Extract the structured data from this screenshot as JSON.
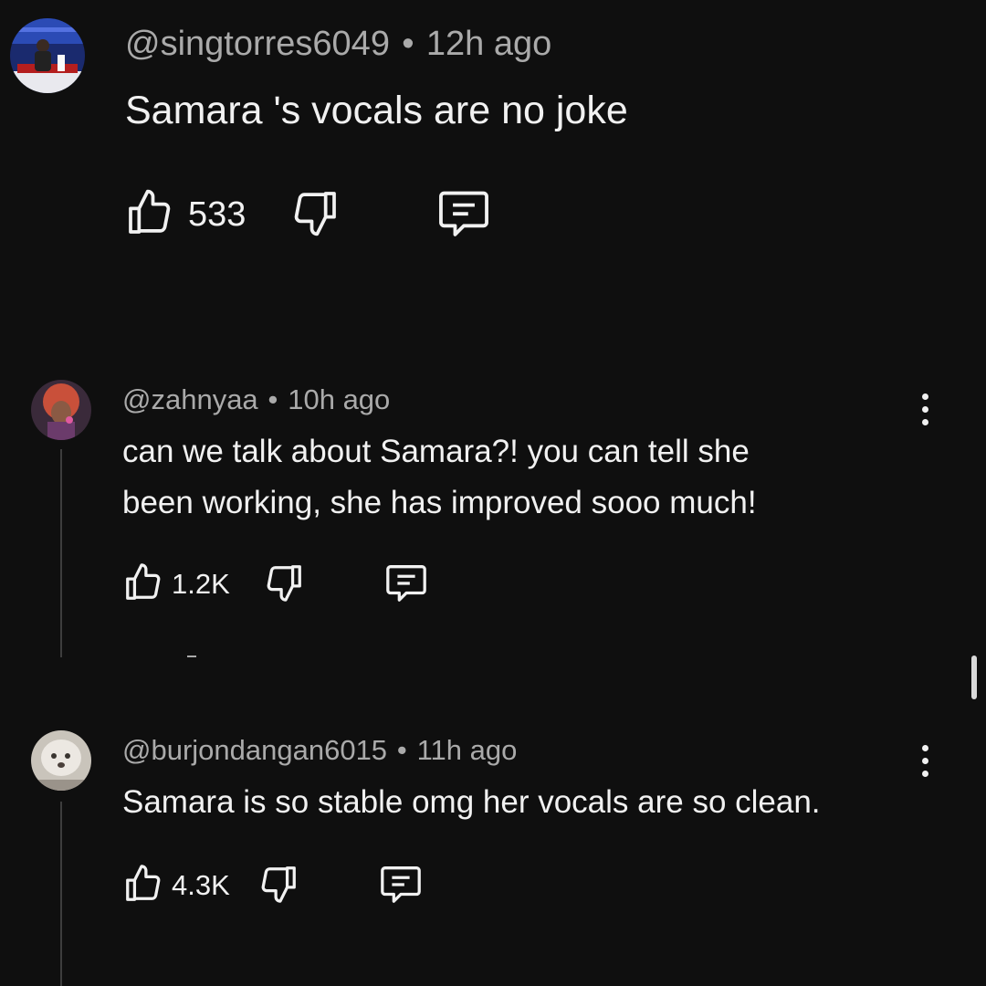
{
  "comments": [
    {
      "username": "@singtorres6049",
      "time": "12h ago",
      "text": "Samara 's vocals are no joke",
      "likes": "533"
    },
    {
      "username": "@zahnyaa",
      "time": "10h ago",
      "text_line1": "can we talk about Samara?! you can tell she",
      "text_line2": "been working, she has improved sooo much!",
      "likes": "1.2K"
    },
    {
      "username": "@burjondangan6015",
      "time": "11h ago",
      "text": "Samara is so stable omg her vocals are so clean.",
      "likes": "4.3K"
    }
  ],
  "separator": "•",
  "icons": {
    "like": "thumbs-up-icon",
    "dislike": "thumbs-down-icon",
    "reply": "comment-icon",
    "more": "vertical-dots-icon"
  },
  "colors": {
    "background": "#0f0f0f",
    "text": "#f1f1f1",
    "meta": "#aaaaaa"
  }
}
